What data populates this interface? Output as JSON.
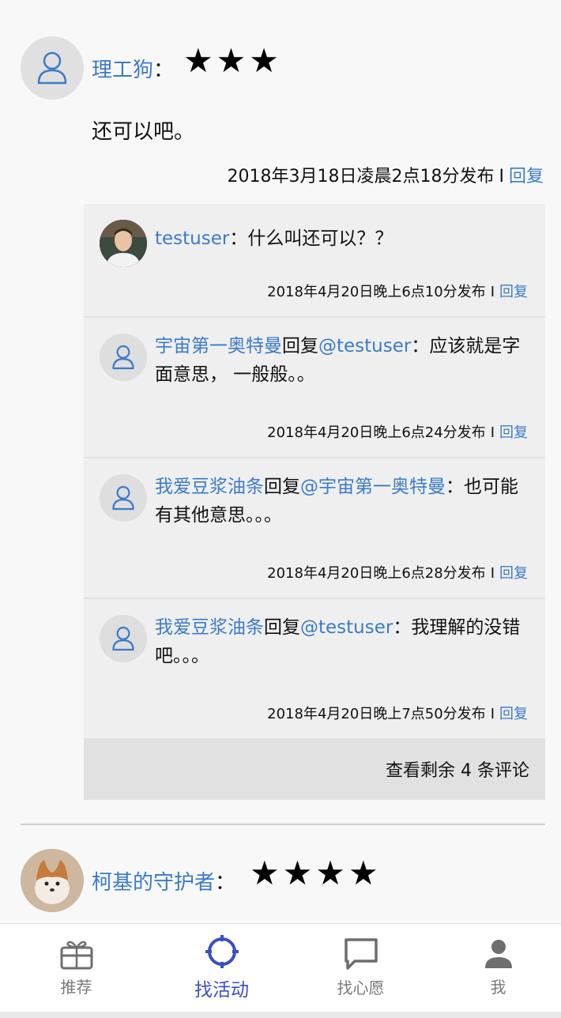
{
  "comment1": {
    "user": "理工狗",
    "colon": "：",
    "stars": "★★★",
    "text": "还可以吧。",
    "time": "2018年3月18日凌晨2点18分发布",
    "sep": "I",
    "reply_label": "回复"
  },
  "replies": [
    {
      "user": "testuser",
      "reply_word": "",
      "target": "",
      "colon": "：",
      "text": "什么叫还可以？？",
      "time": "2018年4月20日晚上6点10分发布",
      "sep": "I",
      "reply_label": "回复"
    },
    {
      "user": "宇宙第一奥特曼",
      "reply_word": "回复",
      "target": "@testuser",
      "colon": "：",
      "text": "应该就是字面意思，  一般般。。",
      "time": "2018年4月20日晚上6点24分发布",
      "sep": "I",
      "reply_label": "回复"
    },
    {
      "user": "我爱豆浆油条",
      "reply_word": "回复",
      "target": "@宇宙第一奥特曼",
      "colon": "：",
      "text": "也可能有其他意思。。。",
      "time": "2018年4月20日晚上6点28分发布",
      "sep": "I",
      "reply_label": "回复"
    },
    {
      "user": "我爱豆浆油条",
      "reply_word": "回复",
      "target": "@testuser",
      "colon": "：",
      "text": "我理解的没错吧。。。",
      "time": "2018年4月20日晚上7点50分发布",
      "sep": "I",
      "reply_label": "回复"
    }
  ],
  "more_comments": "查看剩余 4 条评论",
  "comment2": {
    "user": "柯基的守护者",
    "colon": "：",
    "stars": "★★★★"
  },
  "tabs": [
    {
      "label": "推荐",
      "icon": "gift-icon"
    },
    {
      "label": "找活动",
      "icon": "target-icon"
    },
    {
      "label": "找心愿",
      "icon": "chat-icon"
    },
    {
      "label": "我",
      "icon": "person-icon"
    }
  ],
  "colors": {
    "accent": "#3b7bc8",
    "tab_active": "#3a4fc4"
  }
}
